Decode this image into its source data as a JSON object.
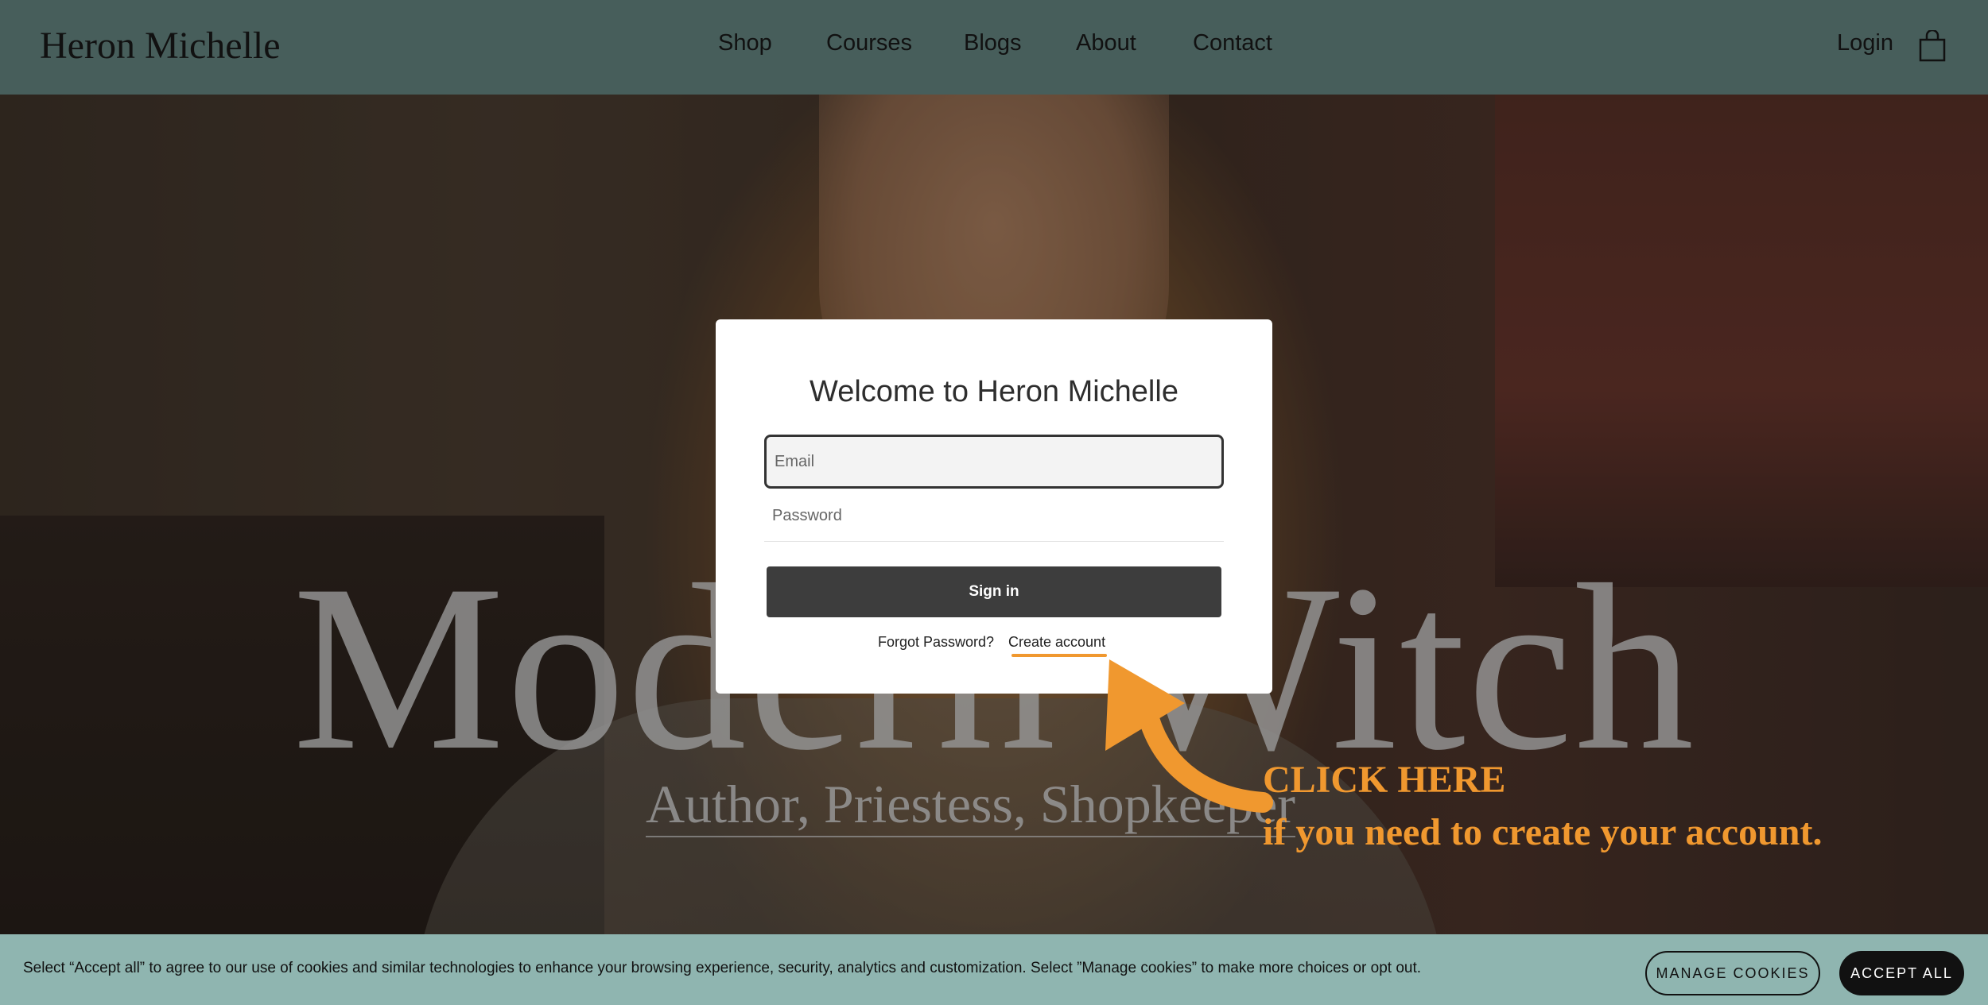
{
  "header": {
    "logo": "Heron Michelle",
    "nav": [
      {
        "label": "Shop"
      },
      {
        "label": "Courses"
      },
      {
        "label": "Blogs"
      },
      {
        "label": "About"
      },
      {
        "label": "Contact"
      }
    ],
    "login": "Login",
    "cart_icon": "shopping-bag-icon"
  },
  "hero": {
    "title": "Modern Witch",
    "subtitle": "Author, Priestess, Shopkeeper"
  },
  "modal": {
    "title": "Welcome to Heron Michelle",
    "email_placeholder": "Email",
    "password_placeholder": "Password",
    "signin": "Sign in",
    "forgot": "Forgot Password?",
    "create": "Create account"
  },
  "annotation": {
    "line1": "CLICK HERE",
    "line2": "if you need to create your account.",
    "color": "#f0982f"
  },
  "cookie": {
    "text": "Select “Accept all” to agree to our use of cookies and similar technologies to enhance your browsing experience, security, analytics and customization. Select ”Manage cookies” to make more choices or opt out.",
    "manage": "MANAGE COOKIES",
    "accept": "ACCEPT ALL"
  },
  "colors": {
    "header_bg": "#475e5b",
    "cookie_bg": "#8fb5b0",
    "signin_bg": "#3d3d3d",
    "accent": "#f0982f"
  }
}
